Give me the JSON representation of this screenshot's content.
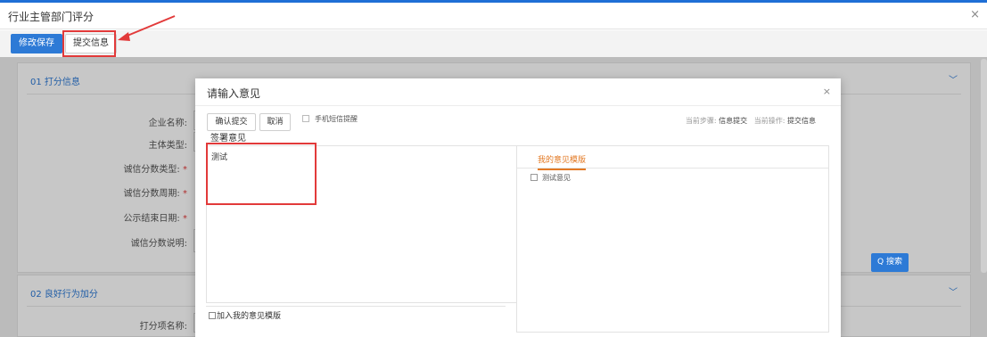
{
  "window": {
    "title": "行业主管部门评分",
    "close_glyph": "×"
  },
  "toolbar": {
    "save_label": "修改保存",
    "submit_label": "提交信息"
  },
  "section1": {
    "heading": "01  打分信息",
    "fields": [
      {
        "label": "企业名称:",
        "required": false
      },
      {
        "label": "主体类型:",
        "required": false
      },
      {
        "label": "诚信分数类型:",
        "required": true
      },
      {
        "label": "诚信分数周期:",
        "required": true
      },
      {
        "label": "公示结束日期:",
        "required": true
      },
      {
        "label": "诚信分数说明:",
        "required": false
      }
    ],
    "required_mark": "*"
  },
  "section2": {
    "heading": "02  良好行为加分",
    "score_name_label": "打分项名称:",
    "search_label": "Q 搜索"
  },
  "modal": {
    "title": "请输入意见",
    "close_glyph": "×",
    "confirm_label": "确认提交",
    "cancel_label": "取消",
    "sms_label": "手机短信提醒",
    "current_step_label": "当前步骤:",
    "current_step_value": "信息提交",
    "current_action_label": "当前操作:",
    "current_action_value": "提交信息",
    "opinion_label": "签署意见",
    "opinion_text": "测试",
    "add_template_label": "加入我的意见模版",
    "template_tab": "我的意见模版",
    "template_items": [
      "测试意见"
    ]
  },
  "icons": {
    "chevron": "chevron-down-icon",
    "close": "close-icon",
    "search": "search-icon"
  },
  "colors": {
    "primary": "#2d7ad6",
    "highlight": "#e23a3a",
    "accent_tab": "#e37a25"
  }
}
